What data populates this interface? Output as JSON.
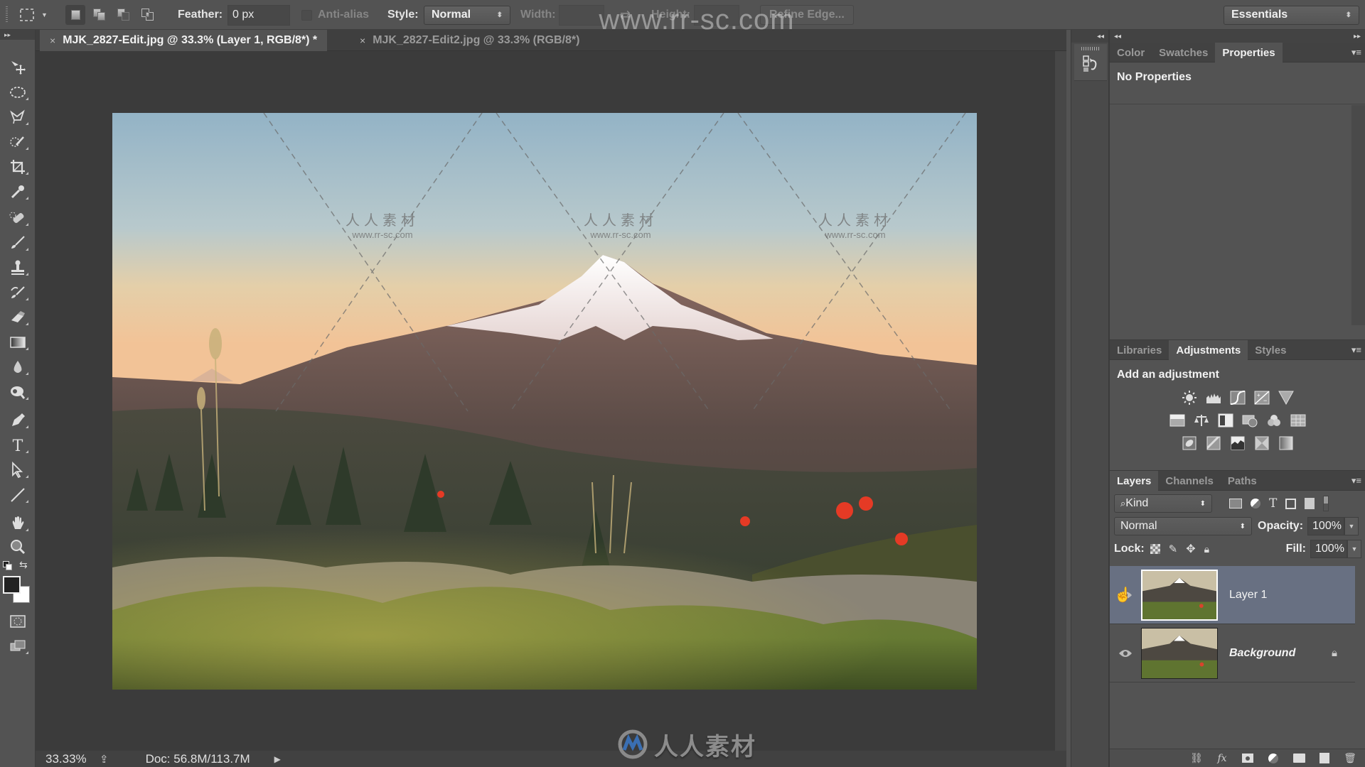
{
  "watermark": {
    "url_overlay": "www.rr-sc.com",
    "small_cn": "人人素材",
    "small_url": "www.rr-sc.com",
    "logo_text": "人人素材"
  },
  "options_bar": {
    "tool_icon": "rectangular-marquee-icon",
    "selection_modes": [
      "new-selection",
      "add-to-selection",
      "subtract-from-selection",
      "intersect-with-selection"
    ],
    "feather_label": "Feather:",
    "feather_value": "0 px",
    "anti_alias_label": "Anti-alias",
    "anti_alias_checked": false,
    "style_label": "Style:",
    "style_value": "Normal",
    "width_label": "Width:",
    "width_value": "",
    "height_label": "Height:",
    "height_value": "",
    "refine_edge_label": "Refine Edge...",
    "workspace_value": "Essentials"
  },
  "document_tabs": [
    {
      "close": "×",
      "label": "MJK_2827-Edit.jpg @ 33.3% (Layer 1, RGB/8*) *",
      "active": true
    },
    {
      "close": "×",
      "label": "MJK_2827-Edit2.jpg @ 33.3% (RGB/8*)",
      "active": false
    }
  ],
  "tools": [
    "move-tool",
    "elliptical-marquee-tool",
    "polygonal-lasso-tool",
    "quick-selection-tool",
    "crop-tool",
    "eyedropper-tool",
    "spot-healing-brush-tool",
    "brush-tool",
    "clone-stamp-tool",
    "history-brush-tool",
    "eraser-tool",
    "gradient-tool",
    "blur-tool",
    "dodge-tool",
    "pen-tool",
    "type-tool",
    "path-selection-tool",
    "line-tool",
    "hand-tool",
    "zoom-tool"
  ],
  "colors": {
    "foreground": "#222222",
    "background": "#ffffff",
    "selected_layer": "#687082",
    "panel_bg": "#535353",
    "canvas_bg": "#3b3b3b"
  },
  "status_bar": {
    "zoom": "33.33%",
    "doc_size": "Doc: 56.8M/113.7M"
  },
  "properties_panel": {
    "tabs": [
      "Color",
      "Swatches",
      "Properties"
    ],
    "active_tab": "Properties",
    "content": "No Properties"
  },
  "adjustments_panel": {
    "tabs": [
      "Libraries",
      "Adjustments",
      "Styles"
    ],
    "active_tab": "Adjustments",
    "heading": "Add an adjustment",
    "rows": [
      [
        "brightness-contrast",
        "levels",
        "curves",
        "exposure",
        "vibrance"
      ],
      [
        "hue-saturation",
        "color-balance",
        "black-white",
        "photo-filter",
        "channel-mixer",
        "color-lookup"
      ],
      [
        "invert",
        "posterize",
        "threshold",
        "selective-color",
        "gradient-map"
      ]
    ]
  },
  "layers_panel": {
    "tabs": [
      "Layers",
      "Channels",
      "Paths"
    ],
    "active_tab": "Layers",
    "filter_label": "Kind",
    "blend_mode": "Normal",
    "opacity_label": "Opacity:",
    "opacity_value": "100%",
    "lock_label": "Lock:",
    "fill_label": "Fill:",
    "fill_value": "100%",
    "layers": [
      {
        "name": "Layer 1",
        "visible": true,
        "selected": true,
        "locked": false
      },
      {
        "name": "Background",
        "visible": true,
        "selected": false,
        "locked": true
      }
    ],
    "bottom_actions": [
      "link-layers",
      "add-layer-style",
      "add-mask",
      "new-fill-adjustment-layer",
      "new-group",
      "new-layer",
      "delete-layer"
    ]
  }
}
